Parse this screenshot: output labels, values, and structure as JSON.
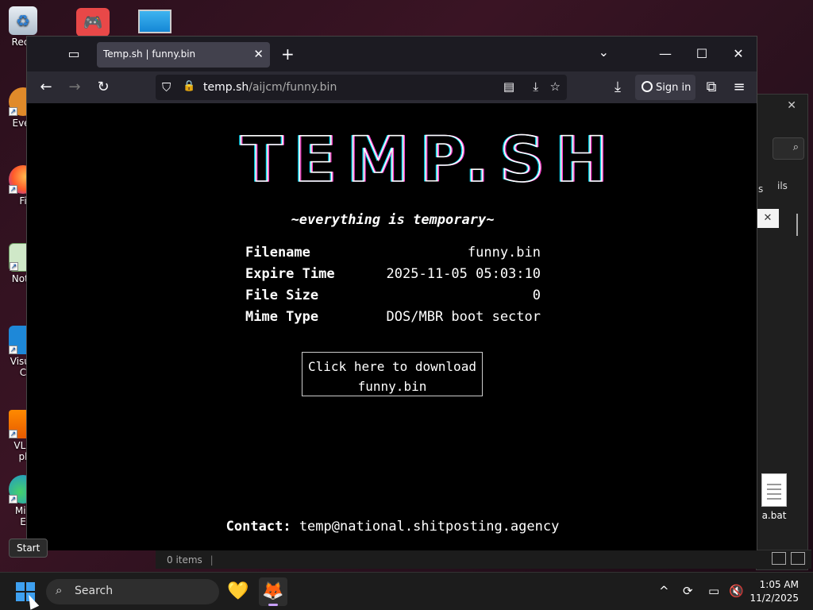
{
  "desktop": {
    "icons": [
      {
        "label": "Recy",
        "name": "recycle-bin-icon"
      },
      {
        "label": "",
        "name": "game-app-icon"
      },
      {
        "label": "",
        "name": "monitor-icon"
      },
      {
        "label": "Ever",
        "name": "everything-icon"
      },
      {
        "label": "Fi",
        "name": "firefox-shortcut-icon"
      },
      {
        "label": "Note",
        "name": "notepad-icon"
      },
      {
        "label": "Visua",
        "label2": "C",
        "name": "vscode-icon"
      },
      {
        "label": "VLC",
        "label2": "pl",
        "name": "vlc-icon"
      },
      {
        "label": "Mic",
        "label2": "E",
        "name": "edge-icon"
      }
    ],
    "a_bat_label": "a.bat"
  },
  "explorer_bg": {
    "frag_s": "s",
    "frag_ils": "ils",
    "status_items": "0 items"
  },
  "browser": {
    "tab_title": "Temp.sh | funny.bin",
    "url_host": "temp.sh",
    "url_path": "/aijcm/funny.bin",
    "sign_in": "Sign in"
  },
  "page": {
    "logo": "TEMP.SH",
    "tagline": "~everything is temporary~",
    "info": [
      {
        "label": "Filename",
        "value": "funny.bin"
      },
      {
        "label": "Expire Time",
        "value": "2025-11-05 05:03:10"
      },
      {
        "label": "File Size",
        "value": "0"
      },
      {
        "label": "Mime Type",
        "value": "DOS/MBR boot sector"
      }
    ],
    "download_line1": "Click here to download",
    "download_line2": "funny.bin",
    "contact_label": "Contact:",
    "contact_email": "temp@national.shitposting.agency"
  },
  "taskbar": {
    "start_tooltip": "Start",
    "search_placeholder": "Search",
    "time": "1:05 AM",
    "date": "11/2/2025"
  },
  "colors": {
    "accent_start": "#3ea0f0",
    "firefox_chrome": "#2b2a33",
    "tab_active": "#42414d"
  }
}
